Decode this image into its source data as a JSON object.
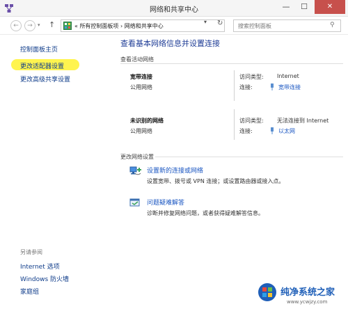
{
  "window": {
    "title": "网络和共享中心",
    "controls": {
      "minimize": "—",
      "maximize": "☐",
      "close": "✕"
    }
  },
  "addressbar": {
    "back": "←",
    "forward": "→",
    "recent": "▾",
    "up": "↑",
    "path": "« 所有控制面板项 › 网络和共享中心",
    "dropdown": "▾",
    "refresh": "↻",
    "search_placeholder": "搜索控制面板",
    "search_icon": "⚲"
  },
  "sidebar": {
    "items": [
      {
        "label": "控制面板主页"
      },
      {
        "label": "更改适配器设置"
      },
      {
        "label": "更改高级共享设置"
      }
    ],
    "see_also_title": "另请参阅",
    "see_also": [
      {
        "label": "Internet 选项"
      },
      {
        "label": "Windows 防火墙"
      },
      {
        "label": "家庭组"
      }
    ]
  },
  "main": {
    "title": "查看基本网络信息并设置连接",
    "active_title": "查看活动网络",
    "networks": [
      {
        "name": "宽带连接",
        "type": "公用网络",
        "access_label": "访问类型:",
        "access_value": "Internet",
        "conn_label": "连接:",
        "conn_value": "宽带连接"
      },
      {
        "name": "未识别的网络",
        "type": "公用网络",
        "access_label": "访问类型:",
        "access_value": "无法连接到 Internet",
        "conn_label": "连接:",
        "conn_value": "以太网"
      }
    ],
    "change_title": "更改网络设置",
    "tasks": [
      {
        "link": "设置新的连接或网络",
        "desc": "设置宽带、拨号或 VPN 连接；或设置路由器或接入点。"
      },
      {
        "link": "问题疑难解答",
        "desc": "诊断并修复网络问题，或者获得疑难解答信息。"
      }
    ]
  },
  "watermark": {
    "title": "纯净系统之家",
    "url": "www.ycwjzy.com"
  },
  "colors": {
    "link": "#1a56c2",
    "nav_link": "#0f3c8a",
    "highlight": "#fff44f",
    "close_button": "#c7504c"
  }
}
